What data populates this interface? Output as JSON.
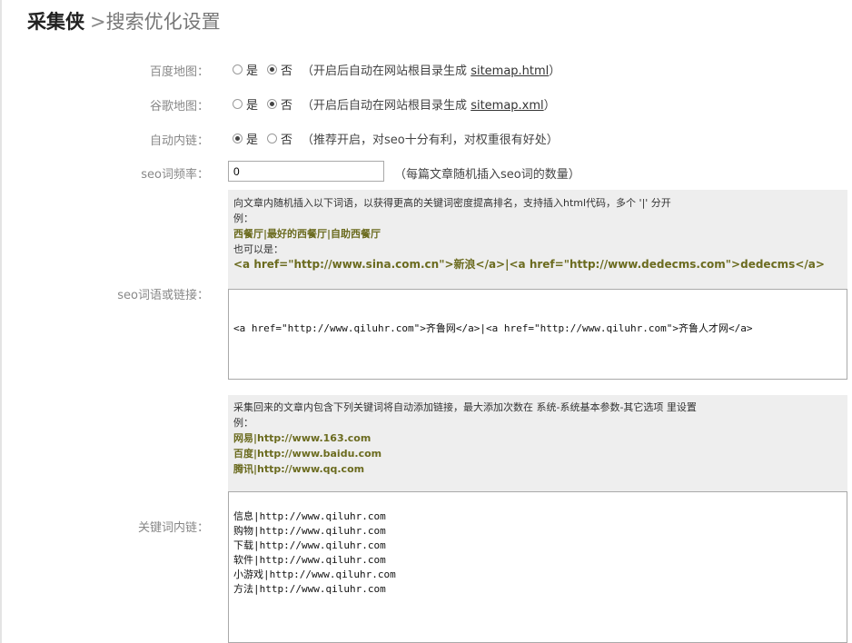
{
  "title": {
    "brand": "采集侠",
    "separator": ">",
    "subtitle": "搜索优化设置"
  },
  "baidu_map": {
    "label": "百度地图：",
    "yes": "是",
    "no": "否",
    "selected": "否",
    "hint_prefix": "（开启后自动在网站根目录生成",
    "hint_file": "sitemap.html",
    "hint_suffix": "）"
  },
  "google_map": {
    "label": "谷歌地图：",
    "yes": "是",
    "no": "否",
    "selected": "否",
    "hint_prefix": "（开启后自动在网站根目录生成",
    "hint_file": "sitemap.xml",
    "hint_suffix": "）"
  },
  "auto_link": {
    "label": "自动内链：",
    "yes": "是",
    "no": "否",
    "selected": "是",
    "hint": "（推荐开启，对seo十分有利，对权重很有好处）"
  },
  "seo_freq": {
    "label": "seo词频率：",
    "value": "0",
    "hint": "（每篇文章随机插入seo词的数量）"
  },
  "seo_words": {
    "label": "seo词语或链接：",
    "help_line1": "向文章内随机插入以下词语，以获得更高的关键词密度提高排名，支持插入html代码，多个 '|' 分开",
    "help_example_label": "例：",
    "help_example1": "西餐厅|最好的西餐厅|自助西餐厅",
    "help_also": "也可以是：",
    "help_example2": "<a href=\"http://www.sina.com.cn\">新浪</a>|<a href=\"http://www.dedecms.com\">dedecms</a>",
    "value": "<a href=\"http://www.qiluhr.com\">齐鲁网</a>|<a href=\"http://www.qiluhr.com\">齐鲁人才网</a>"
  },
  "keyword_link": {
    "label": "关键词内链：",
    "help_line1": "采集回来的文章内包含下列关键词将自动添加链接，最大添加次数在 系统-系统基本参数-其它选项 里设置",
    "help_example_label": "例：",
    "help_examples": [
      "网易|http://www.163.com",
      "百度|http://www.baidu.com",
      "腾讯|http://www.qq.com"
    ],
    "lines": [
      "信息|http://www.qiluhr.com",
      "购物|http://www.qiluhr.com",
      "下载|http://www.qiluhr.com",
      "软件|http://www.qiluhr.com",
      "小游戏|http://www.qiluhr.com",
      "方法|http://www.qiluhr.com"
    ]
  }
}
